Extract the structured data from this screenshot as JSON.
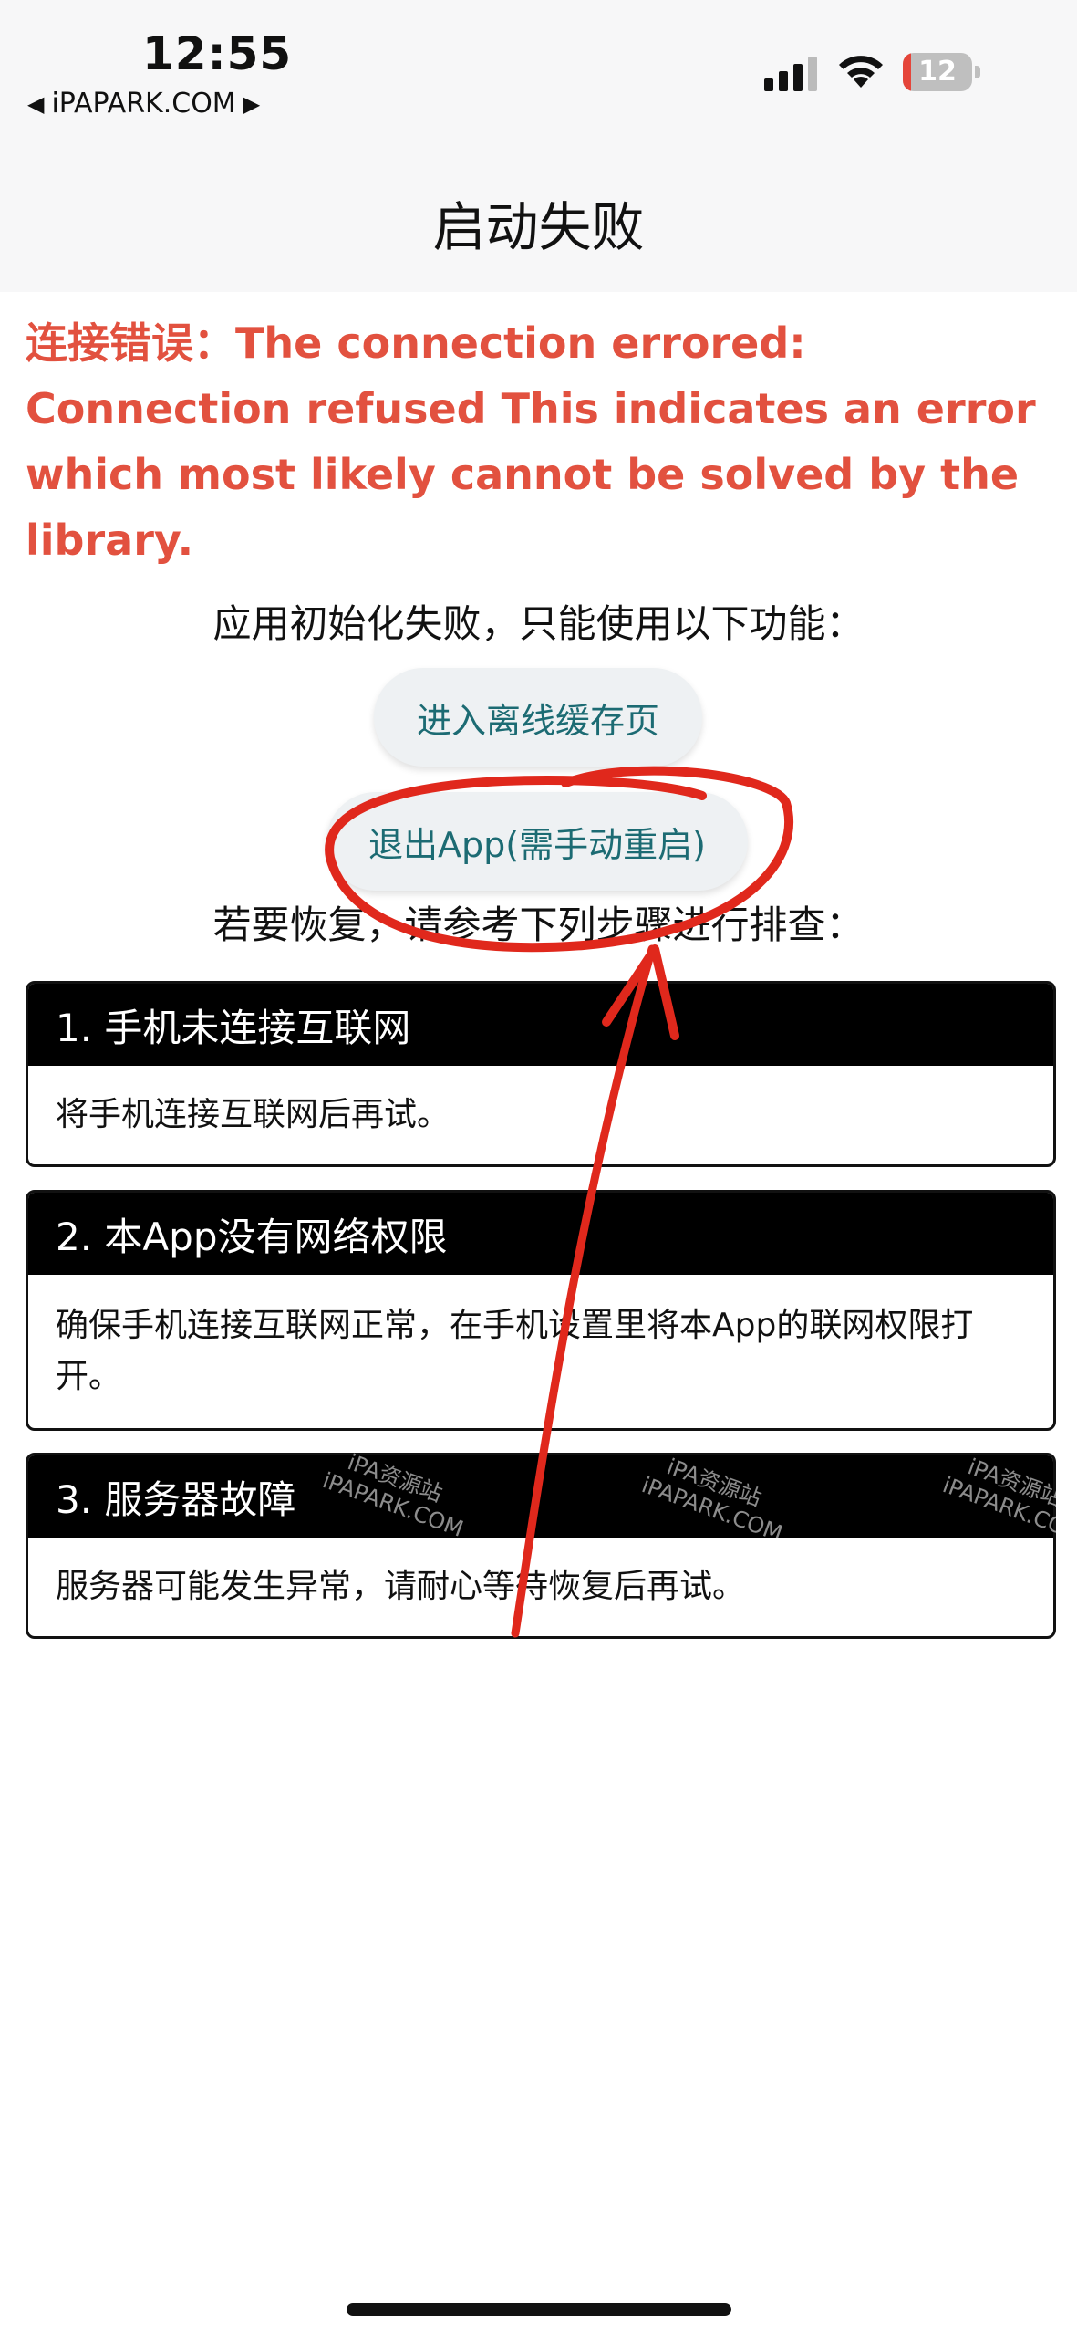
{
  "status_bar": {
    "time": "12:55",
    "back_app": "iPAPARK.COM",
    "battery_level": "12",
    "battery_color": "#e5453a"
  },
  "nav": {
    "title": "启动失败"
  },
  "error": {
    "message": "连接错误：The connection errored: Connection refused This indicates an error which most likely cannot be solved by the library.",
    "color": "#e2513f"
  },
  "intro": "应用初始化失败，只能使用以下功能：",
  "buttons": {
    "offline": "进入离线缓存页",
    "exit": "退出App(需手动重启)"
  },
  "hint": "若要恢复，请参考下列步骤进行排查：",
  "steps": [
    {
      "title": "1. 手机未连接互联网",
      "body": "将手机连接互联网后再试。"
    },
    {
      "title": "2. 本App没有网络权限",
      "body": "确保手机连接互联网正常，在手机设置里将本App的联网权限打开。"
    },
    {
      "title": "3. 服务器故障",
      "body": "服务器可能发生异常，请耐心等待恢复后再试。"
    }
  ],
  "watermarks": [
    "iPA资源站",
    "iPAPARK.COM"
  ]
}
